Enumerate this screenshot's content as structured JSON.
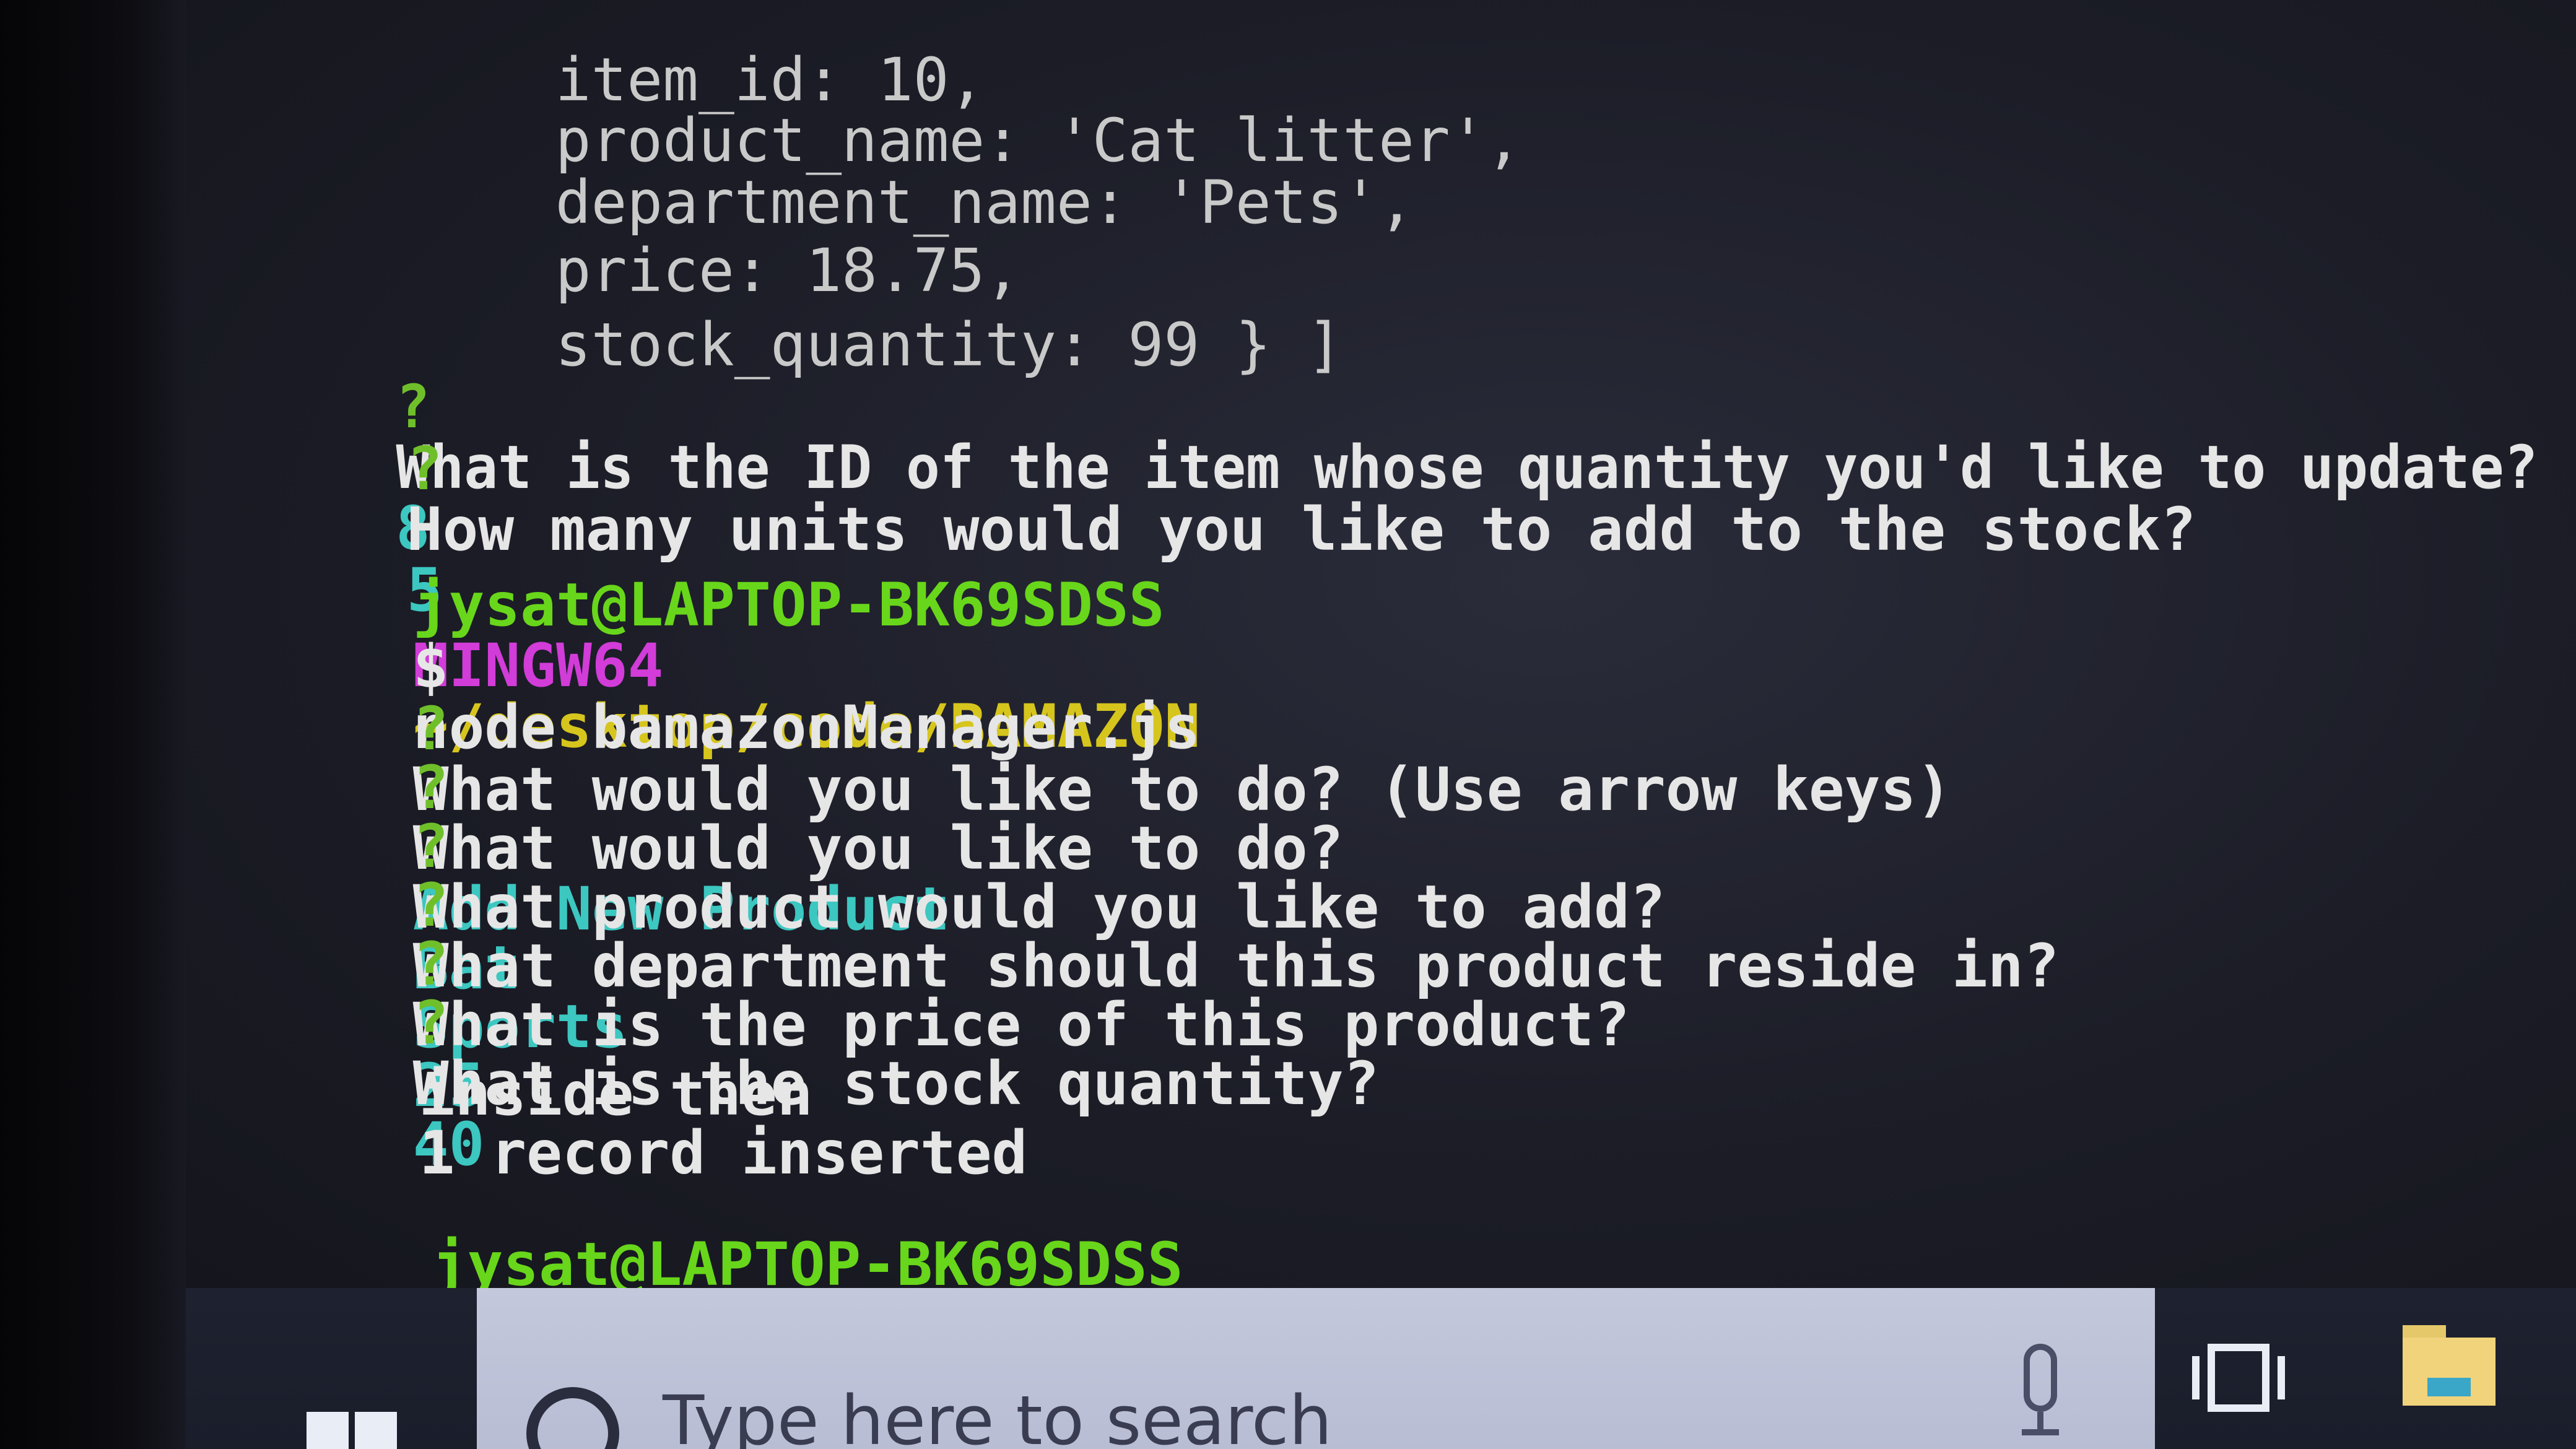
{
  "terminal": {
    "object_lines": [
      "item_id: 10,",
      "product_name: 'Cat litter',",
      "department_name: 'Pets',",
      "price: 18.75,",
      "stock_quantity: 99 } ]"
    ],
    "prompt_mark": "?",
    "update_q1": "What is the ID of the item whose quantity you'd like to update?",
    "update_a1": "8",
    "update_q2": "How many units would you like to add to the stock?",
    "update_a2": "5",
    "user_host": "jysat@LAPTOP-BK69SDSS",
    "shell_name": "MINGW64",
    "cwd": "~/desktop/code/BAMAZON",
    "dollar": "$",
    "command": "node bamazonManager.js",
    "q_action_hint": "What would you like to do? (Use arrow keys)",
    "q_action": "What would you like to do?",
    "a_action": "Add New Product",
    "q_product": "What product would you like to add?",
    "a_product": "Bat",
    "q_department": "What department should this product reside in?",
    "a_department": "Sports",
    "q_price": "What is the price of this product?",
    "a_price": "25",
    "q_stock": "What is the stock quantity?",
    "a_stock": "40",
    "output_1": "inside then",
    "output_2": "1 record inserted"
  },
  "taskbar": {
    "search_placeholder": "Type here to search",
    "icons": [
      "windows-start-icon",
      "search-icon",
      "microphone-icon",
      "task-view-icon",
      "file-explorer-icon"
    ]
  },
  "colors": {
    "prompt_green": "#6fbf2a",
    "answer_cyan": "#3cc7c1",
    "user_green": "#68d61a",
    "mingw_magenta": "#d23cd8",
    "path_yellow": "#d6c51c"
  }
}
